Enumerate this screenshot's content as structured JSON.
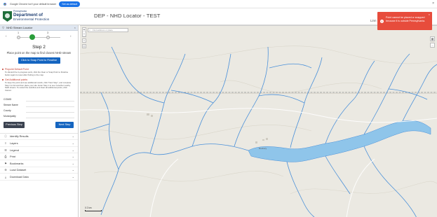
{
  "browser_bar": {
    "message": "Google Chrome isn't your default browser",
    "set_default_label": "Set as default",
    "close_glyph": "×"
  },
  "header": {
    "logo": {
      "line1": "Pennsylvania",
      "line2": "Department of",
      "line3": "Environmental Protection"
    },
    "title": "DEP - NHD Locator - TEST",
    "user_link": "Linn"
  },
  "sidebar": {
    "title": "NHD Stream Locator",
    "steps": [
      "1",
      "2",
      "3"
    ],
    "current_step": 2,
    "step_title": "Step 2",
    "instruction": "Place point on the map to find closest NHD stream",
    "snap_button": "Click to Snap Point to Flowline",
    "note1": {
      "heading": "Pinpoint Default Point",
      "text": "To discard the in-progress point, click the Clear or Snap Point to Flowline button again to reset after finding to the map."
    },
    "note2": {
      "heading": "Get Additional points",
      "text": "To keep the point and see additional results, click \"Next Step\", and complete Step 3 to list and then place your site. Enter Step 1 to see if another nearby NHD stream. To restart the workflow and clear all additional points, click Cancel."
    },
    "fields": [
      {
        "label": "COMID",
        "value": ""
      },
      {
        "label": "Stream Name",
        "value": ""
      },
      {
        "label": "County",
        "value": ""
      },
      {
        "label": "Municipality",
        "value": ""
      }
    ],
    "prev_button": "Previous Step",
    "next_button": "Next Step",
    "panels": [
      {
        "icon": "info-icon",
        "glyph": "ⓘ",
        "label": "Identify Results"
      },
      {
        "icon": "layers-icon",
        "glyph": "≡",
        "label": "Layers"
      },
      {
        "icon": "legend-icon",
        "glyph": "☰",
        "label": "Legend"
      },
      {
        "icon": "print-icon",
        "glyph": "⎙",
        "label": "Print"
      },
      {
        "icon": "bookmark-icon",
        "glyph": "⚑",
        "label": "Bookmarks"
      },
      {
        "icon": "load-dataset-icon",
        "glyph": "⊕",
        "label": "Load Dataset"
      },
      {
        "icon": "download-icon",
        "glyph": "⤓",
        "label": "Download Data"
      }
    ],
    "chevron_glyph": "⌄"
  },
  "map": {
    "search_placeholder": "Find address or place",
    "zoom_in": "+",
    "zoom_out": "−",
    "scale_label": "0  2 km",
    "town_labels": [
      "Roxbury"
    ]
  },
  "toast": {
    "message": "Point cannot be placed or snapped because it is outside Pennsylvania.",
    "close_glyph": "×",
    "color": "#e74c3c"
  },
  "colors": {
    "primary": "#1565c0",
    "active_step": "#2a9d3a",
    "water": "#8fc5ea",
    "stream": "#4a90d9"
  }
}
